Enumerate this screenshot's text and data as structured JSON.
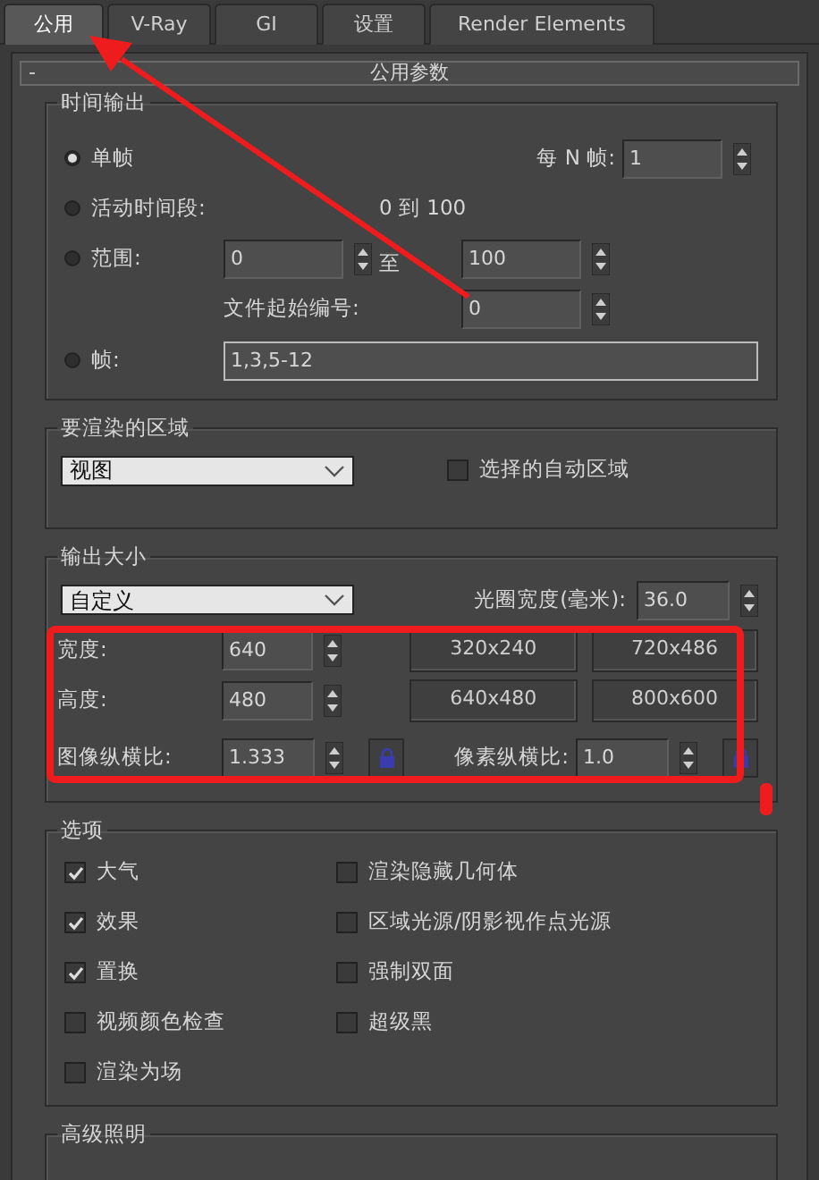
{
  "tabs": [
    {
      "label": "公用",
      "selected": true
    },
    {
      "label": "V-Ray",
      "selected": false
    },
    {
      "label": "GI",
      "selected": false
    },
    {
      "label": "设置",
      "selected": false
    },
    {
      "label": "Render Elements",
      "selected": false
    }
  ],
  "rollout": {
    "toggle": "-",
    "title": "公用参数"
  },
  "time_output": {
    "title": "时间输出",
    "modes": [
      {
        "label": "单帧",
        "selected": true
      },
      {
        "label": "活动时间段:",
        "selected": false
      },
      {
        "label": "范围:",
        "selected": false
      },
      {
        "label": "帧:",
        "selected": false
      }
    ],
    "every_nth": {
      "label": "每 N 帧:",
      "value": "1"
    },
    "active_range": "0 到 100",
    "range_start": "0",
    "range_to": "至",
    "range_end": "100",
    "file_start": {
      "label": "文件起始编号:",
      "value": "0"
    },
    "frames": "1,3,5-12"
  },
  "render_area": {
    "title": "要渲染的区域",
    "dropdown": "视图",
    "auto_region": {
      "label": "选择的自动区域",
      "checked": false
    }
  },
  "output_size": {
    "title": "输出大小",
    "dropdown": "自定义",
    "aperture": {
      "label": "光圈宽度(毫米):",
      "value": "36.0"
    },
    "width": {
      "label": "宽度:",
      "value": "640"
    },
    "height": {
      "label": "高度:",
      "value": "480"
    },
    "presets": [
      "320x240",
      "720x486",
      "640x480",
      "800x600"
    ],
    "image_aspect": {
      "label": "图像纵横比:",
      "value": "1.333"
    },
    "pixel_aspect": {
      "label": "像素纵横比:",
      "value": "1.0"
    }
  },
  "options": {
    "title": "选项",
    "items": [
      {
        "label": "大气",
        "checked": true
      },
      {
        "label": "渲染隐藏几何体",
        "checked": false
      },
      {
        "label": "效果",
        "checked": true
      },
      {
        "label": "区域光源/阴影视作点光源",
        "checked": false
      },
      {
        "label": "置换",
        "checked": true
      },
      {
        "label": "强制双面",
        "checked": false
      },
      {
        "label": "视频颜色检查",
        "checked": false
      },
      {
        "label": "超级黑",
        "checked": false
      },
      {
        "label": "渲染为场",
        "checked": false
      }
    ]
  },
  "advanced_lighting": {
    "title": "高级照明"
  }
}
